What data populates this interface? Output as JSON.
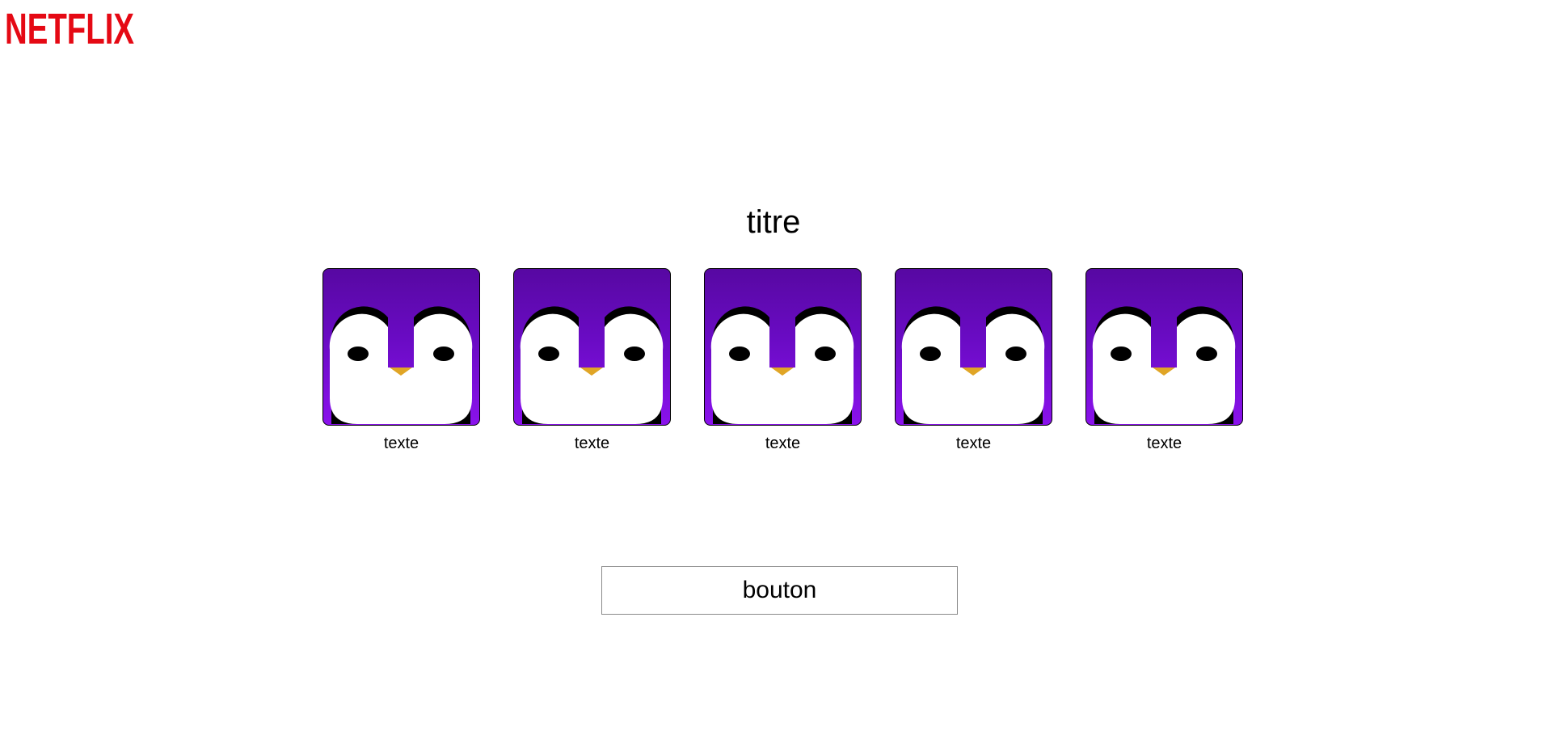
{
  "header": {
    "logo_text": "NETFLIX",
    "logo_color": "#e50914"
  },
  "main": {
    "title": "titre",
    "profiles": [
      {
        "label": "texte",
        "avatar_icon": "penguin-avatar-icon"
      },
      {
        "label": "texte",
        "avatar_icon": "penguin-avatar-icon"
      },
      {
        "label": "texte",
        "avatar_icon": "penguin-avatar-icon"
      },
      {
        "label": "texte",
        "avatar_icon": "penguin-avatar-icon"
      },
      {
        "label": "texte",
        "avatar_icon": "penguin-avatar-icon"
      }
    ],
    "button_label": "bouton"
  },
  "colors": {
    "avatar_top": "#5708a2",
    "avatar_bottom": "#8a12ec",
    "beak": "#e0a526"
  }
}
